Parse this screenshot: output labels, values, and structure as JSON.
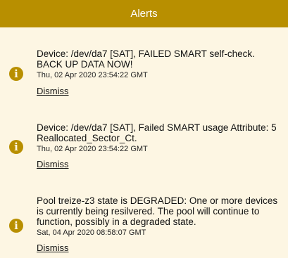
{
  "header": {
    "title": "Alerts"
  },
  "colors": {
    "header_bg": "#b88f00",
    "page_bg": "#fdf6e3",
    "icon_bg": "#b88f00"
  },
  "alerts": [
    {
      "icon": "info-icon",
      "message": "Device: /dev/da7 [SAT], FAILED SMART self-check. BACK UP DATA NOW!",
      "timestamp": "Thu, 02 Apr 2020 23:54:22 GMT",
      "dismiss_label": "Dismiss"
    },
    {
      "icon": "info-icon",
      "message": "Device: /dev/da7 [SAT], Failed SMART usage Attribute: 5 Reallocated_Sector_Ct.",
      "timestamp": "Thu, 02 Apr 2020 23:54:22 GMT",
      "dismiss_label": "Dismiss"
    },
    {
      "icon": "info-icon",
      "message": "Pool treize-z3 state is DEGRADED: One or more devices is currently being resilvered. The pool will continue to function, possibly in a degraded state.",
      "timestamp": "Sat, 04 Apr 2020 08:58:07 GMT",
      "dismiss_label": "Dismiss"
    }
  ]
}
